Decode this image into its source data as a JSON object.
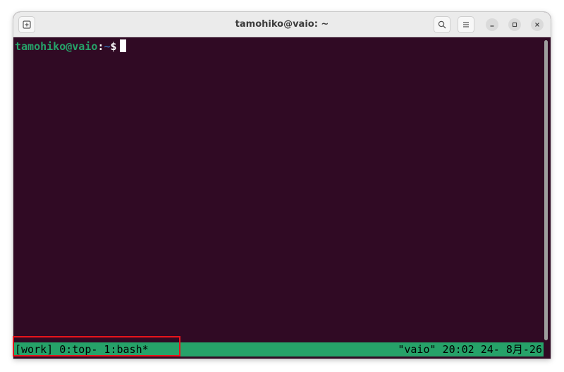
{
  "window": {
    "title": "tamohiko@vaio: ~"
  },
  "toolbar": {
    "new_tab_icon": "new-tab-icon",
    "search_icon": "search-icon",
    "menu_icon": "hamburger-menu-icon",
    "minimize_icon": "minimize-icon",
    "maximize_icon": "maximize-icon",
    "close_icon": "close-icon"
  },
  "terminal": {
    "prompt_user_host": "tamohiko@vaio",
    "prompt_separator": ":",
    "prompt_path": "~",
    "prompt_symbol": "$",
    "background_color": "#300a24",
    "prompt_color": "#26a269",
    "path_color": "#3465a4"
  },
  "tmux_status": {
    "left": "[work] 0:top- 1:bash*",
    "right": "\"vaio\" 20:02 24- 8月-26",
    "background_color": "#26a269"
  },
  "annotation": {
    "highlight_color": "#e8141b"
  }
}
